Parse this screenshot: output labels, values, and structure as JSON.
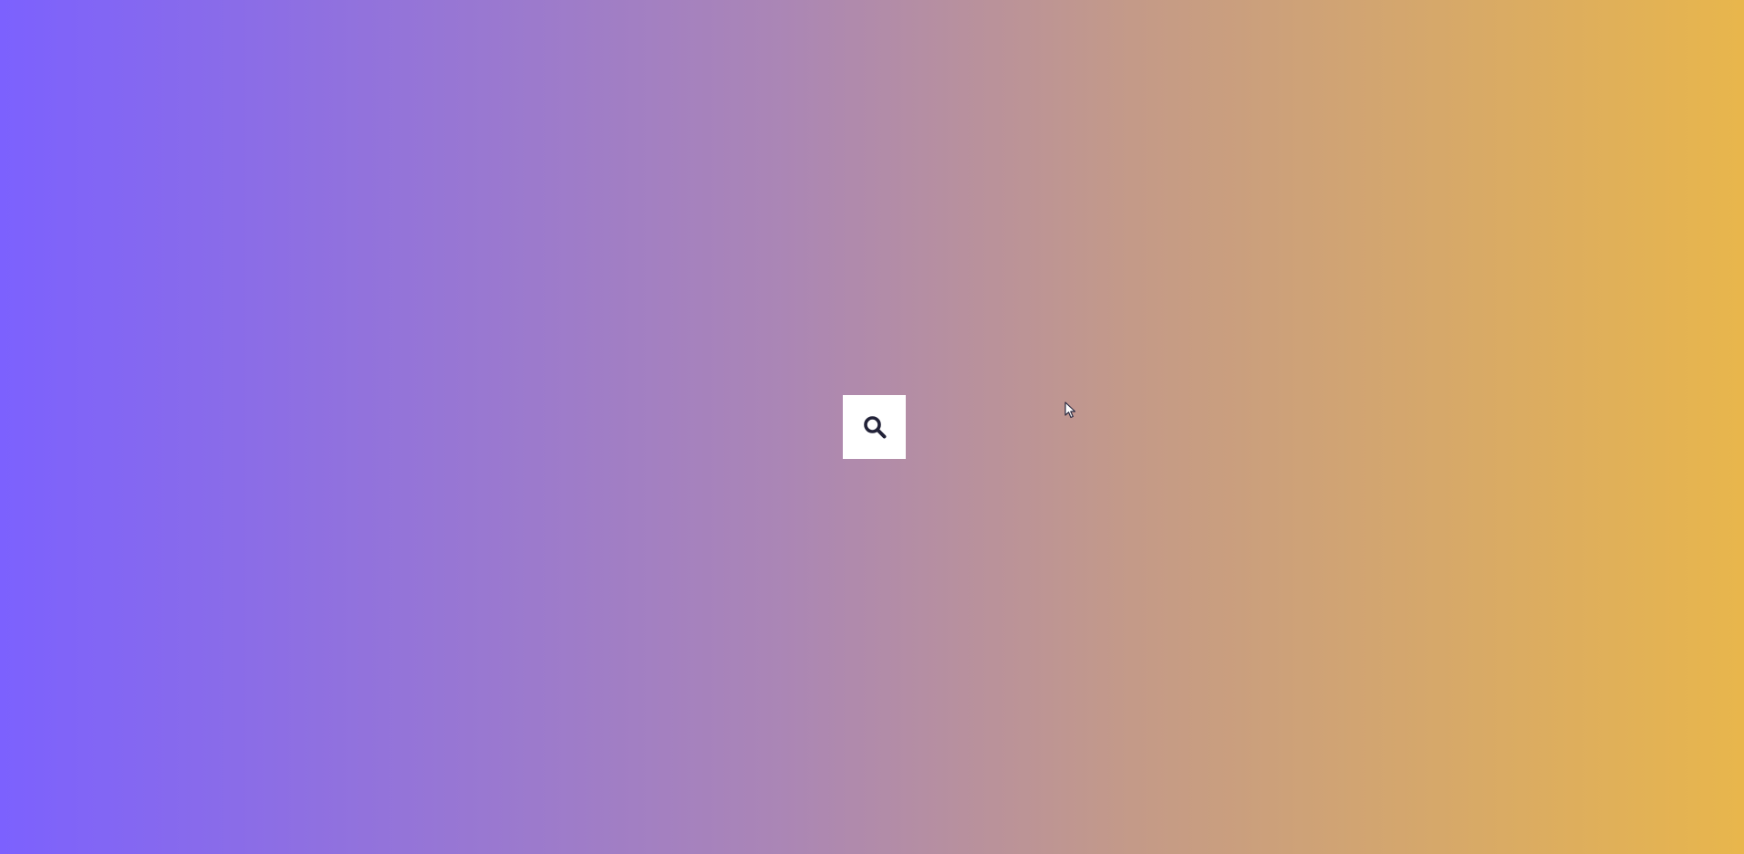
{
  "background": {
    "gradient_start": "#7c61fe",
    "gradient_mid": "#ab86b5",
    "gradient_end": "#e8b64c"
  },
  "search_button": {
    "icon": "search-icon",
    "background": "#ffffff",
    "icon_color": "#222238"
  },
  "cursor": {
    "icon": "pointer-cursor-icon"
  }
}
